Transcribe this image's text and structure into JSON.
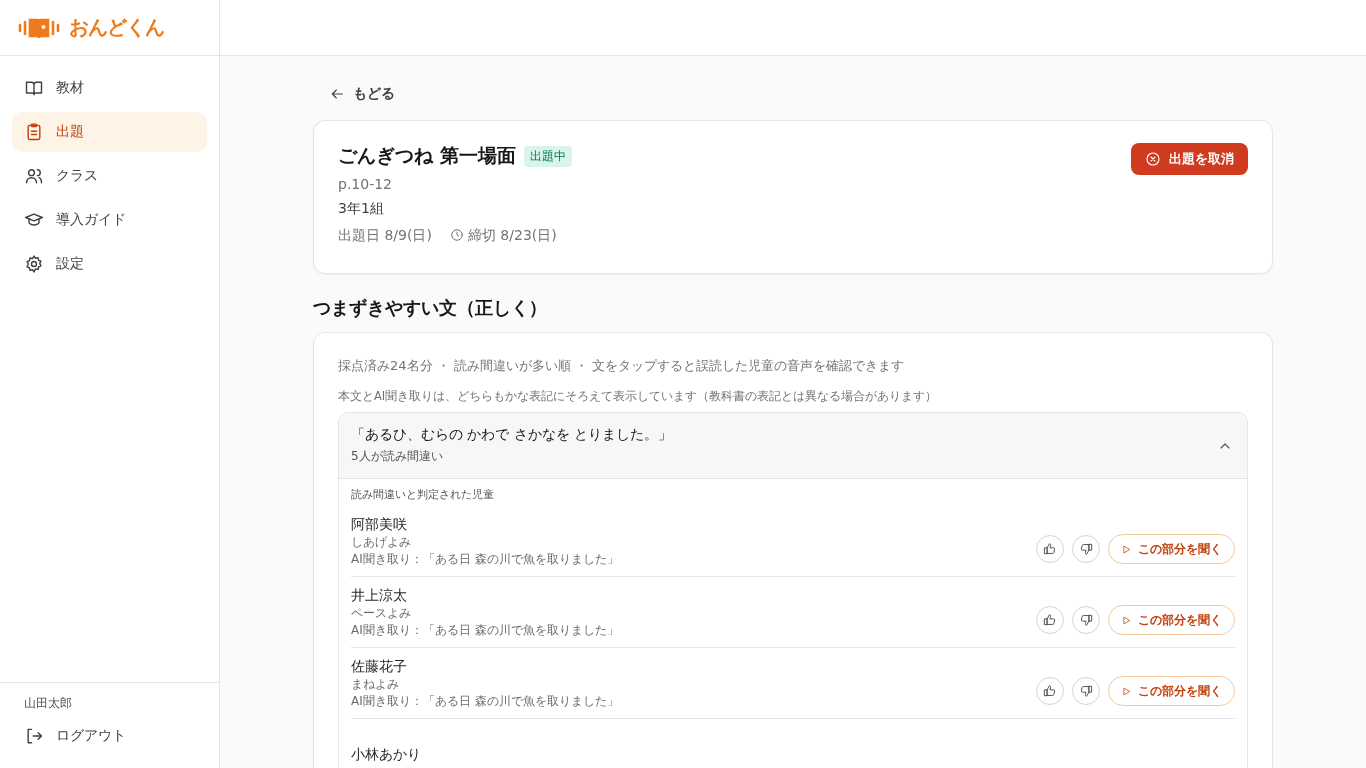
{
  "app": {
    "logo_text": "おんどくん"
  },
  "sidebar": {
    "items": [
      {
        "label": "教材",
        "selected": false
      },
      {
        "label": "出題",
        "selected": true
      },
      {
        "label": "クラス",
        "selected": false
      },
      {
        "label": "導入ガイド",
        "selected": false
      },
      {
        "label": "設定",
        "selected": false
      }
    ],
    "user_name": "山田太郎",
    "logout": "ログアウト"
  },
  "back_link": "もどる",
  "assignment": {
    "title": "ごんぎつね 第一場面",
    "status": "出題中",
    "pages": "p.10-12",
    "class": "3年1組",
    "assigned": "出題日 8/9(日)",
    "deadline": "締切 8/23(日)",
    "cancel_button": "出題を取消"
  },
  "section_title": "つまずきやすい文（正しく）",
  "summary": "採点済み24名分 ・ 読み間違いが多い順 ・ 文をタップすると誤読した児童の音声を確認できます",
  "note": "本文とAI聞き取りは、どちらもかな表記にそろえて表示しています（教科書の表記とは異なる場合があります）",
  "sentences": [
    {
      "text": "「あるひ、むらの かわで さかなを とりました。」",
      "count": "5人が読み間違い",
      "expanded": true,
      "list_label": "読み間違いと判定された児童",
      "students": [
        {
          "name": "阿部美咲",
          "type": "しあげよみ",
          "heard": "AI聞き取り：「ある日 森の川で魚を取りました」",
          "play": "この部分を聞く"
        },
        {
          "name": "井上涼太",
          "type": "ペースよみ",
          "heard": "AI聞き取り：「ある日 森の川で魚を取りました」",
          "play": "この部分を聞く"
        },
        {
          "name": "佐藤花子",
          "type": "まねよみ",
          "heard": "AI聞き取り：「ある日 森の川で魚を取りました」",
          "play": "この部分を聞く"
        },
        {
          "name": "小林あかり"
        }
      ]
    }
  ]
}
